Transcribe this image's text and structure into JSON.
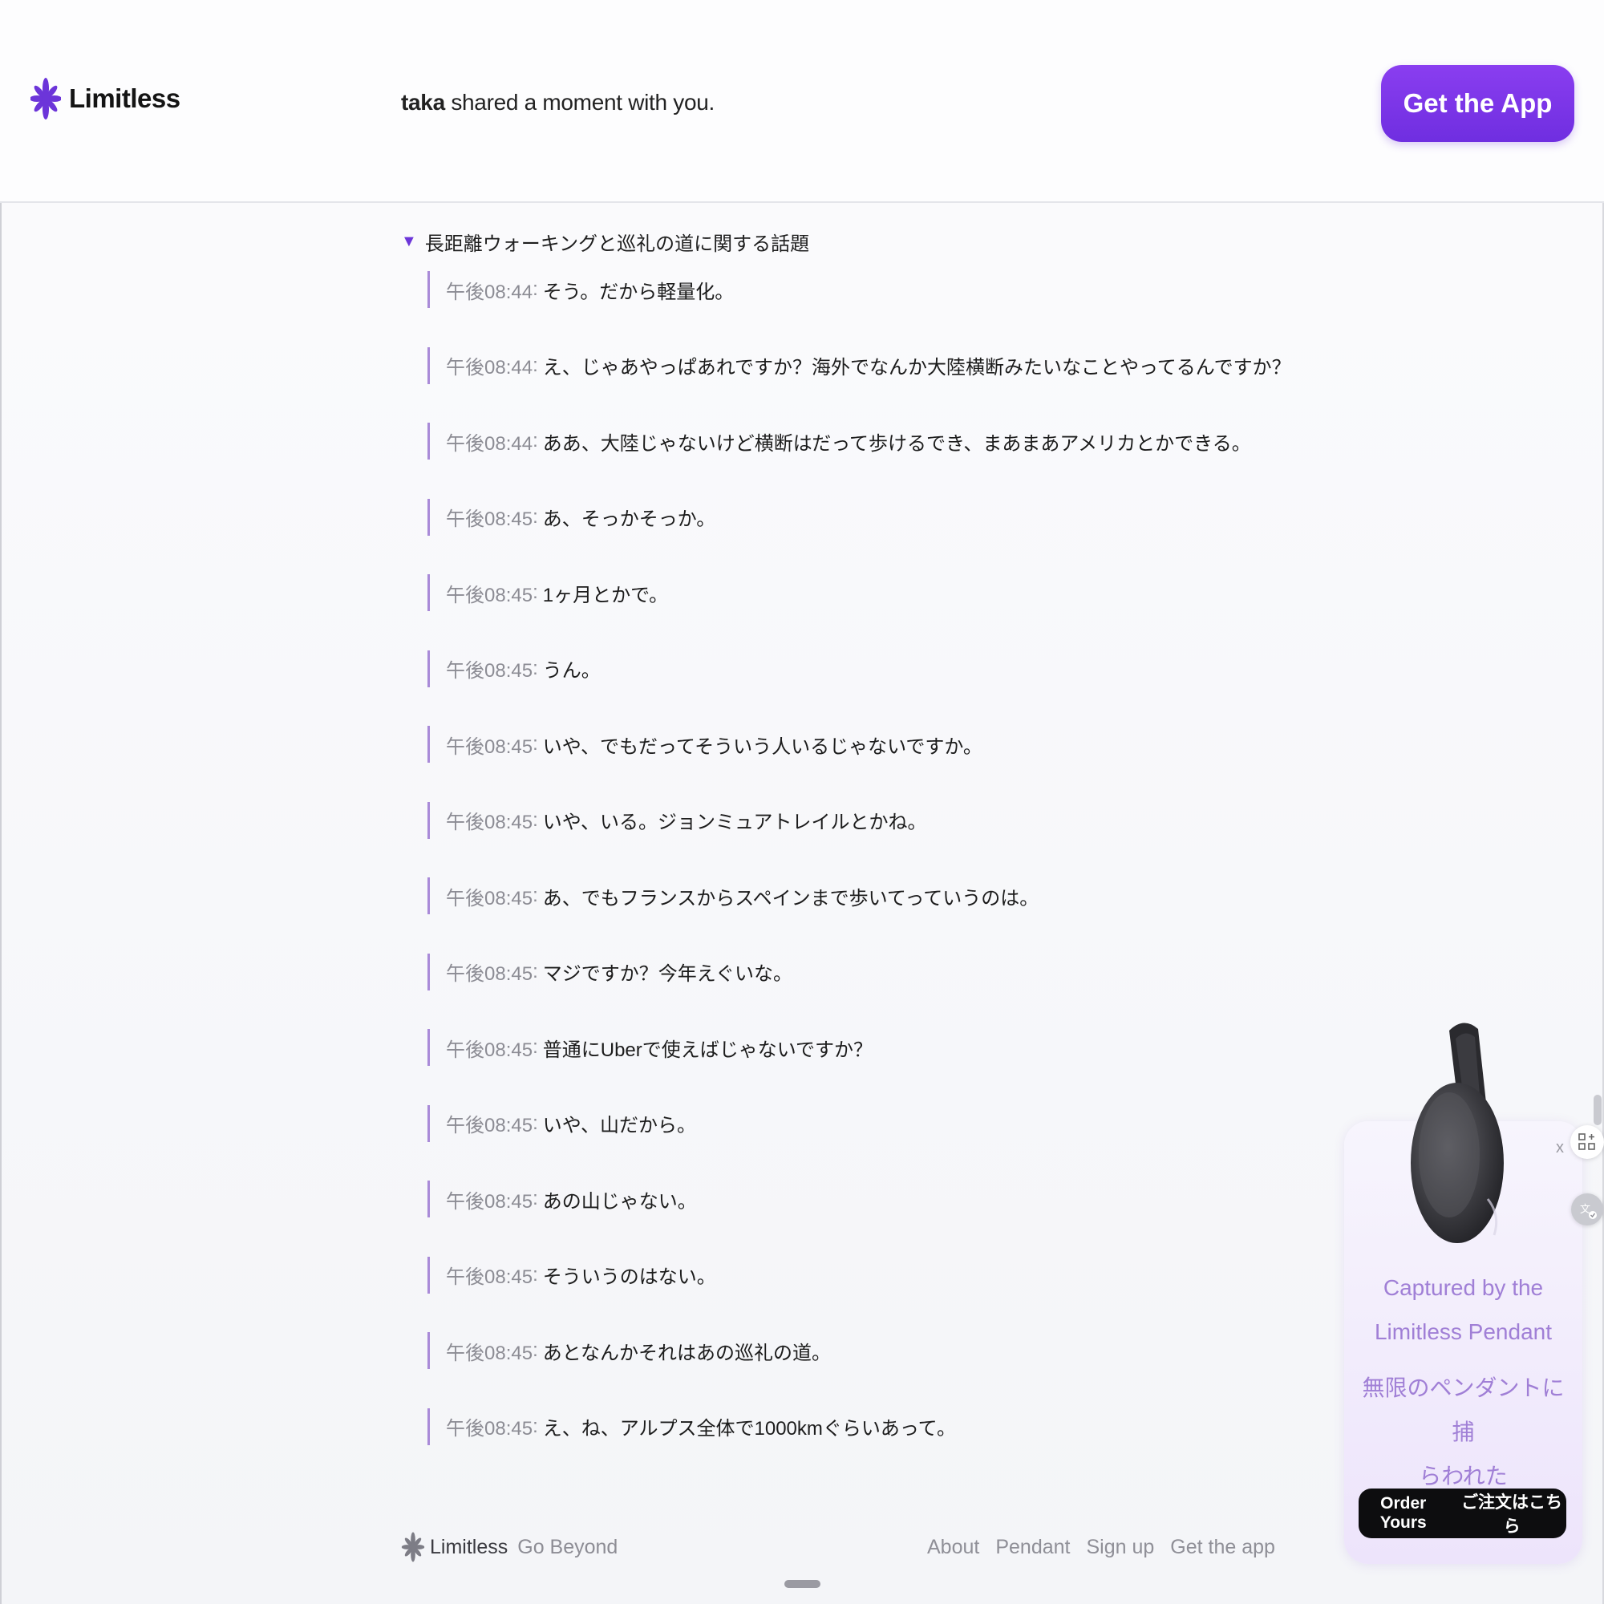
{
  "header": {
    "brand": "Limitless",
    "share_user": "taka",
    "share_text": " shared a moment with you.",
    "get_app_label": "Get the App"
  },
  "topic": {
    "arrow": "▼",
    "title": "長距離ウォーキングと巡礼の道に関する話題"
  },
  "messages": [
    {
      "time": "午後08:44",
      "text": "そう。だから軽量化。"
    },
    {
      "time": "午後08:44",
      "text": "え、じゃあやっぱあれですか？海外でなんか大陸横断みたいなことやってるんですか？"
    },
    {
      "time": "午後08:44",
      "text": "ああ、大陸じゃないけど横断はだって歩けるでき、まあまあアメリカとかできる。"
    },
    {
      "time": "午後08:45",
      "text": "あ、そっかそっか。"
    },
    {
      "time": "午後08:45",
      "text": "1ヶ月とかで。"
    },
    {
      "time": "午後08:45",
      "text": "うん。"
    },
    {
      "time": "午後08:45",
      "text": "いや、でもだってそういう人いるじゃないですか。"
    },
    {
      "time": "午後08:45",
      "text": "いや、いる。ジョンミュアトレイルとかね。"
    },
    {
      "time": "午後08:45",
      "text": "あ、でもフランスからスペインまで歩いてっていうのは。"
    },
    {
      "time": "午後08:45",
      "text": "マジですか？今年えぐいな。"
    },
    {
      "time": "午後08:45",
      "text": "普通にUberで使えばじゃないですか？"
    },
    {
      "time": "午後08:45",
      "text": "いや、山だから。"
    },
    {
      "time": "午後08:45",
      "text": "あの山じゃない。"
    },
    {
      "time": "午後08:45",
      "text": "そういうのはない。"
    },
    {
      "time": "午後08:45",
      "text": "あとなんかそれはあの巡礼の道。"
    },
    {
      "time": "午後08:45",
      "text": "え、ね、アルプス全体で1000kmぐらいあって。"
    }
  ],
  "promo": {
    "close": "x",
    "caption_line1": "Captured by the",
    "caption_line2": "Limitless Pendant",
    "caption_ja_line1": "無限のペンダントに捕",
    "caption_ja_line2": "らわれた",
    "order_label": "Order Yours",
    "order_label_ja": "ご注文はこちら"
  },
  "footer": {
    "brand": "Limitless",
    "tagline": "Go Beyond",
    "links": [
      "About",
      "Pendant",
      "Sign up",
      "Get the app"
    ]
  },
  "colors": {
    "accent": "#7a36e8",
    "quote_bar": "#a98ad8",
    "promo_text": "#a07fd6"
  },
  "icons": [
    "limitless-logo-icon",
    "expand-triangle-icon",
    "qr-add-icon",
    "translate-icon"
  ]
}
